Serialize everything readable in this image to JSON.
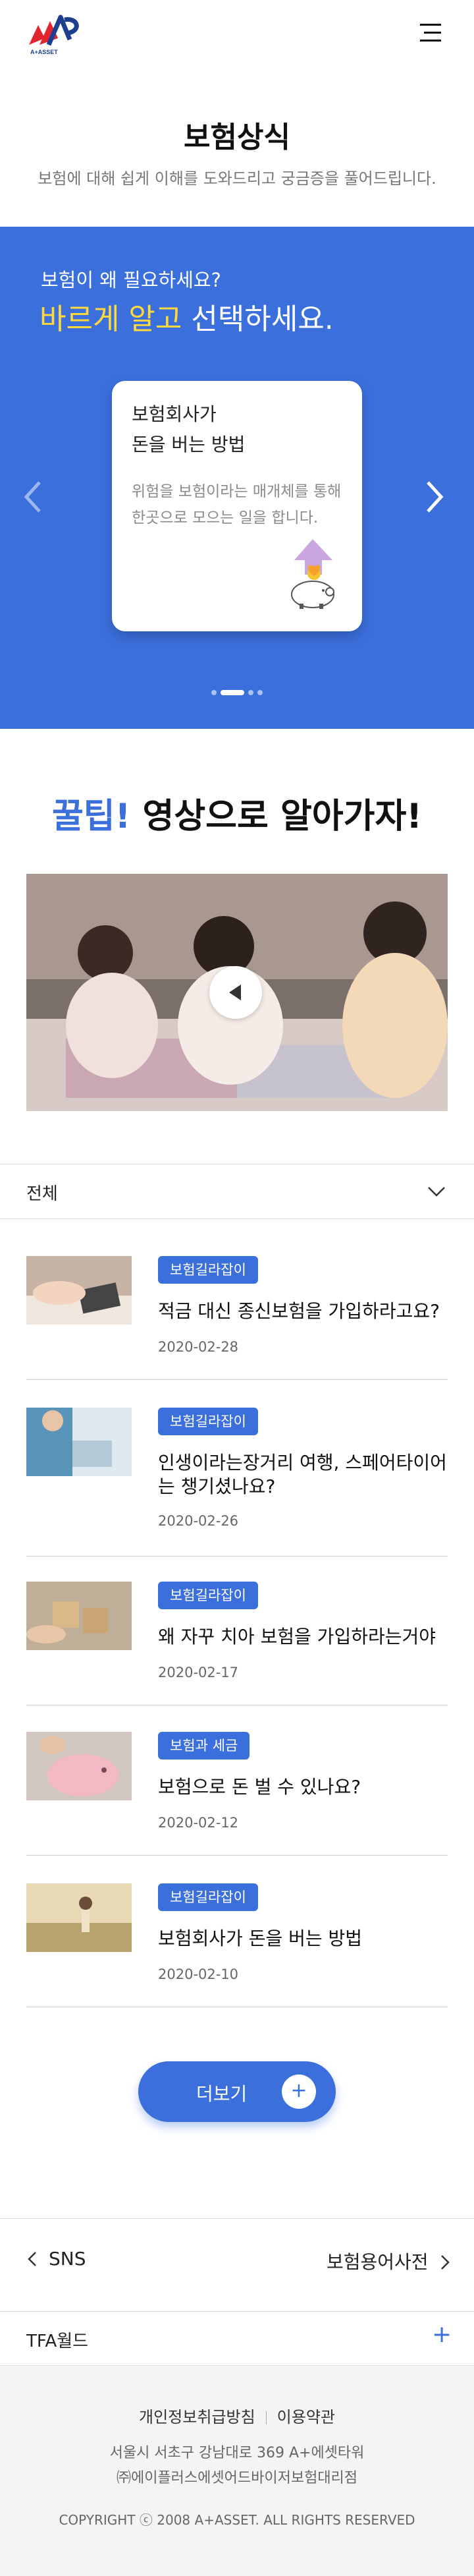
{
  "header": {
    "logo_text": "A+ASSET",
    "menu_icon": "hamburger-menu-icon"
  },
  "page": {
    "title": "보험상식",
    "subtitle": "보험에 대해 쉽게 이해를 도와드리고 궁금증을 풀어드립니다."
  },
  "hero": {
    "question": "보험이 왜 필요하세요?",
    "headline_highlight": "바르게 알고",
    "headline_rest": " 선택하세요.",
    "card": {
      "title_line1": "보험회사가",
      "title_line2": "돈을 버는 방법",
      "desc": "위험을 보험이라는 매개체를 통해 한곳으로 모으는 일을 합니다."
    },
    "slides_total": 4,
    "slide_active": 2,
    "accent_color": "#3b6fdc",
    "highlight_color": "#ffd93b"
  },
  "tips": {
    "headline_blue": "꿀팁!",
    "headline_rest": " 영상으로 알아가자!"
  },
  "filter": {
    "selected": "전체"
  },
  "articles": [
    {
      "tag": "보험길라잡이",
      "title": "적금 대신 종신보험을 가입하라고요?",
      "date": "2020-02-28",
      "thumb": "calculator-photo"
    },
    {
      "tag": "보험길라잡이",
      "title": "인생이라는장거리 여행, 스페어타이어는 챙기셨나요?",
      "date": "2020-02-26",
      "thumb": "doctor-photo"
    },
    {
      "tag": "보험길라잡이",
      "title": "왜 자꾸 치아 보험을 가입하라는거야",
      "date": "2020-02-17",
      "thumb": "puzzle-photo"
    },
    {
      "tag": "보험과 세금",
      "title": "보험으로 돈 벌 수 있나요?",
      "date": "2020-02-12",
      "thumb": "piggy-bank-photo"
    },
    {
      "tag": "보험길라잡이",
      "title": "보험회사가 돈을 버는 방법",
      "date": "2020-02-10",
      "thumb": "field-photo"
    }
  ],
  "more_button": {
    "label": "더보기",
    "plus": "+"
  },
  "links": {
    "sns": "SNS",
    "dictionary": "보험용어사전"
  },
  "tfa": {
    "label": "TFA월드",
    "plus": "+"
  },
  "footer": {
    "privacy": "개인정보취급방침",
    "terms": "이용약관",
    "address": "서울시 서초구 강남대로 369 A+에셋타워",
    "company": "㈜에이플러스에셋어드바이저보험대리점",
    "copyright": "COPYRIGHT ⓒ 2008 A+ASSET. ALL RIGHTS RESERVED"
  }
}
